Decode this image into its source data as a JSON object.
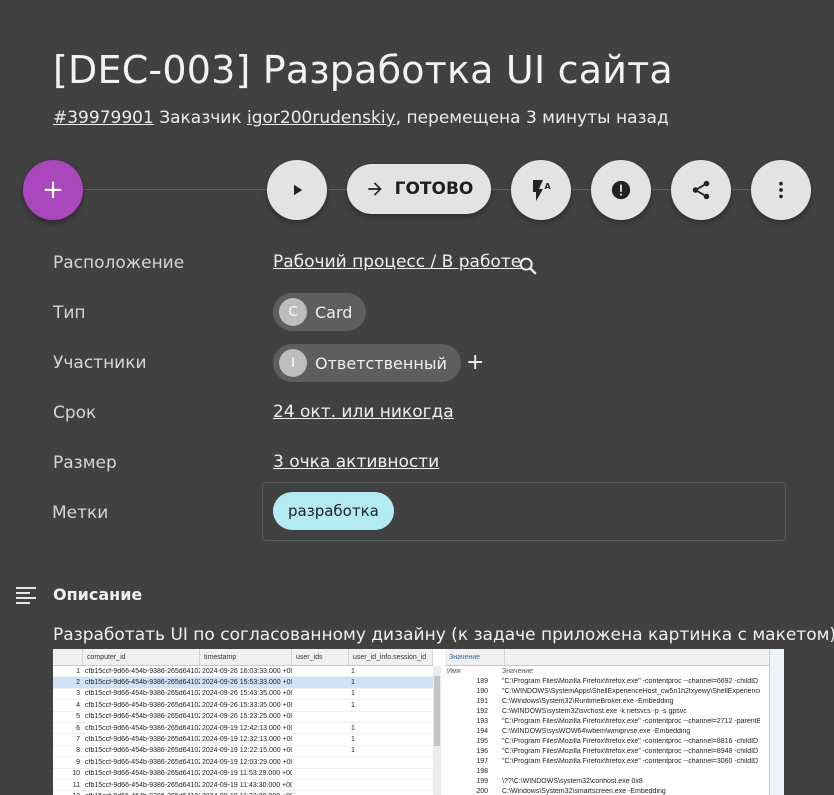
{
  "card": {
    "title": "[DEC-003] Разработка UI сайта",
    "number": "#39979901",
    "customer_prefix": "Заказчик",
    "customer": "igor200rudenskiy",
    "moved": ", перемещена 3 минуты назад"
  },
  "actions": {
    "add_label": "+",
    "done_label": "ГОТОВО"
  },
  "fields": {
    "location_label": "Расположение",
    "location_value": "Рабочий процесс / В работе",
    "type_label": "Тип",
    "type_avatar": "C",
    "type_value": "Card",
    "members_label": "Участники",
    "members_avatar": "I",
    "members_value": "Ответственный",
    "members_add": "+",
    "due_label": "Срок",
    "due_value": "24 окт. или никогда",
    "size_label": "Размер",
    "size_value": "3 очка активности",
    "tags_label": "Метки",
    "tag_value": "разработка"
  },
  "description": {
    "title": "Описание",
    "text": "Разработать UI по согласованному дизайну (к задаче приложена картинка с макетом)"
  },
  "attachment": {
    "headers": [
      "computer_id",
      "timestamp",
      "user_ids",
      "user_id_info.session_id"
    ],
    "rows": [
      {
        "n": "1",
        "id": "cfb15ccf-9d66-454b-9386-265d641027e",
        "ts": "2024-09-26 16:03:33.000 +0000",
        "v": "1"
      },
      {
        "n": "2",
        "id": "cfb15ccf-9d66-454b-9386-265d641027e",
        "ts": "2024-09-26 15:53:33.000 +0000",
        "v": "1"
      },
      {
        "n": "3",
        "id": "cfb15ccf-9d66-454b-9386-265d641027e",
        "ts": "2024-09-26 15:43:35.000 +0000",
        "v": "1"
      },
      {
        "n": "4",
        "id": "cfb15ccf-9d66-454b-9386-265d641027e",
        "ts": "2024-09-26 15:33:35.000 +0000",
        "v": "1"
      },
      {
        "n": "5",
        "id": "cfb15ccf-9d66-454b-9386-265d641027e",
        "ts": "2024-09-26 15:23:25.000 +0000",
        "v": ""
      },
      {
        "n": "6",
        "id": "cfb15ccf-9d66-454b-9386-265d641027e",
        "ts": "2024-09-19 12:42:13.000 +0000",
        "v": "1"
      },
      {
        "n": "7",
        "id": "cfb15ccf-9d66-454b-9386-265d641027e",
        "ts": "2024-09-19 12:32:13.000 +0000",
        "v": "1"
      },
      {
        "n": "8",
        "id": "cfb15ccf-9d66-454b-9386-265d641027e",
        "ts": "2024-09-19 12:22:15.000 +0000",
        "v": "1"
      },
      {
        "n": "9",
        "id": "cfb15ccf-9d66-454b-9386-265d641027e",
        "ts": "2024-09-19 12:03:29.000 +0000",
        "v": ""
      },
      {
        "n": "10",
        "id": "cfb15ccf-9d66-454b-9386-265d641027e",
        "ts": "2024-09-19 11:53:29.000 +0000",
        "v": ""
      },
      {
        "n": "11",
        "id": "cfb15ccf-9d66-454b-9386-265d641027e",
        "ts": "2024-09-19 11:43:30.000 +0000",
        "v": ""
      },
      {
        "n": "12",
        "id": "cfb15ccf-9d66-454b-9386-265d641027e",
        "ts": "2024-09-19 11:33:29.000 +0000",
        "v": ""
      }
    ],
    "value_tab": "Значение",
    "value_headers": [
      "Имя",
      "Значение"
    ],
    "value_rows": [
      {
        "n": "189",
        "v": "\"C:\\Program Files\\Mozilla Firefox\\firefox.exe\" -contentproc --channel=6692 -childID 4 -is"
      },
      {
        "n": "190",
        "v": "\"C:\\WINDOWS\\SystemApps\\ShellExperienceHost_cw5n1h2txyewy\\ShellExperienceHost.e"
      },
      {
        "n": "191",
        "v": "C:\\Windows\\System32\\RuntimeBroker.exe -Embedding"
      },
      {
        "n": "192",
        "v": "C:\\WINDOWS\\system32\\svchost.exe -k netsvcs -p -s gpsvc"
      },
      {
        "n": "193",
        "v": "\"C:\\Program Files\\Mozilla Firefox\\firefox.exe\" -contentproc --channel=2712 -parentBuildI"
      },
      {
        "n": "194",
        "v": "C:\\WINDOWS\\sysWOW64\\wbem\\wmiprvse.exe -Embedding"
      },
      {
        "n": "195",
        "v": "\"C:\\Program Files\\Mozilla Firefox\\firefox.exe\" -contentproc --channel=8816 -childID 7 -is"
      },
      {
        "n": "196",
        "v": "\"C:\\Program Files\\Mozilla Firefox\\firefox.exe\" -contentproc --channel=8948 -childID 9 -is"
      },
      {
        "n": "197",
        "v": "\"C:\\Program Files\\Mozilla Firefox\\firefox.exe\" -contentproc --channel=3060 -childID 10 -is"
      },
      {
        "n": "198",
        "v": ""
      },
      {
        "n": "199",
        "v": "\\??\\C:\\WINDOWS\\system32\\conhost.exe 0x8"
      },
      {
        "n": "200",
        "v": "C:\\Windows\\System32\\smartscreen.exe -Embedding"
      }
    ],
    "side_label": "Panels"
  }
}
